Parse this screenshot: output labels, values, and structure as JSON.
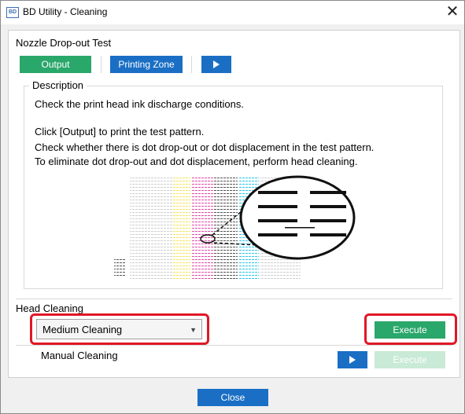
{
  "window": {
    "title": "BD Utility - Cleaning",
    "app_icon_text": "BD"
  },
  "nozzle": {
    "title": "Nozzle Drop-out Test",
    "output_label": "Output",
    "printing_zone_label": "Printing Zone"
  },
  "description": {
    "legend": "Description",
    "line1": "Check the print head ink discharge conditions.",
    "line2": "Click [Output] to print the test pattern.",
    "line3": "Check whether there is dot drop-out or dot displacement in the test pattern.",
    "line4": "To eliminate dot drop-out and dot displacement, perform head cleaning."
  },
  "head_cleaning": {
    "title": "Head Cleaning",
    "selected_mode": "Medium Cleaning",
    "execute_label": "Execute",
    "manual_label": "Manual Cleaning",
    "manual_execute_label": "Execute"
  },
  "footer": {
    "close_label": "Close"
  },
  "colors": {
    "accent_green": "#2aa76a",
    "accent_blue": "#1a6fc4",
    "highlight_red": "#e01826"
  },
  "icons": {
    "play": "play-icon",
    "close": "close-icon",
    "dropdown": "chevron-down-icon"
  }
}
